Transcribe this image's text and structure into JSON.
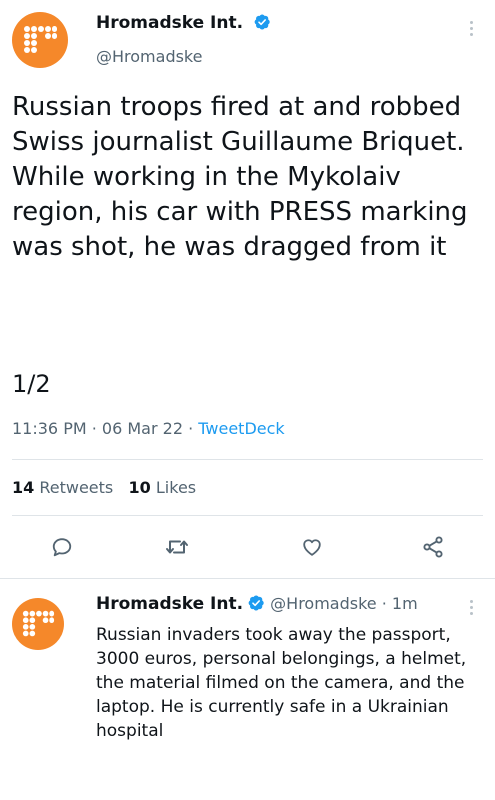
{
  "main_tweet": {
    "display_name": "Hromadske Int.",
    "handle": "@Hromadske",
    "text": "Russian troops fired at and robbed Swiss journalist Guillaume Briquet. While working in the Mykolaiv region, his car with PRESS marking was shot, he was dragged from it",
    "thread_count": "1/2",
    "time": "11:36 PM",
    "date": "06 Mar 22",
    "source": "TweetDeck",
    "retweets_count": "14",
    "retweets_label": "Retweets",
    "likes_count": "10",
    "likes_label": "Likes"
  },
  "reply_tweet": {
    "display_name": "Hromadske Int.",
    "handle": "@Hromadske",
    "age": "1m",
    "text": "Russian invaders took away the passport, 3000 euros, personal belongings, a helmet, the material filmed on the camera, and the laptop. He is currently safe in a Ukrainian hospital"
  },
  "icons": {
    "verified": "verified-badge-icon",
    "more": "more-options-icon",
    "reply": "reply-icon",
    "retweet": "retweet-icon",
    "like": "like-heart-icon",
    "share": "share-icon"
  },
  "colors": {
    "avatar": "#f5882a",
    "verified": "#1d9bf0",
    "link": "#1d9bf0",
    "secondary_text": "#536471"
  }
}
